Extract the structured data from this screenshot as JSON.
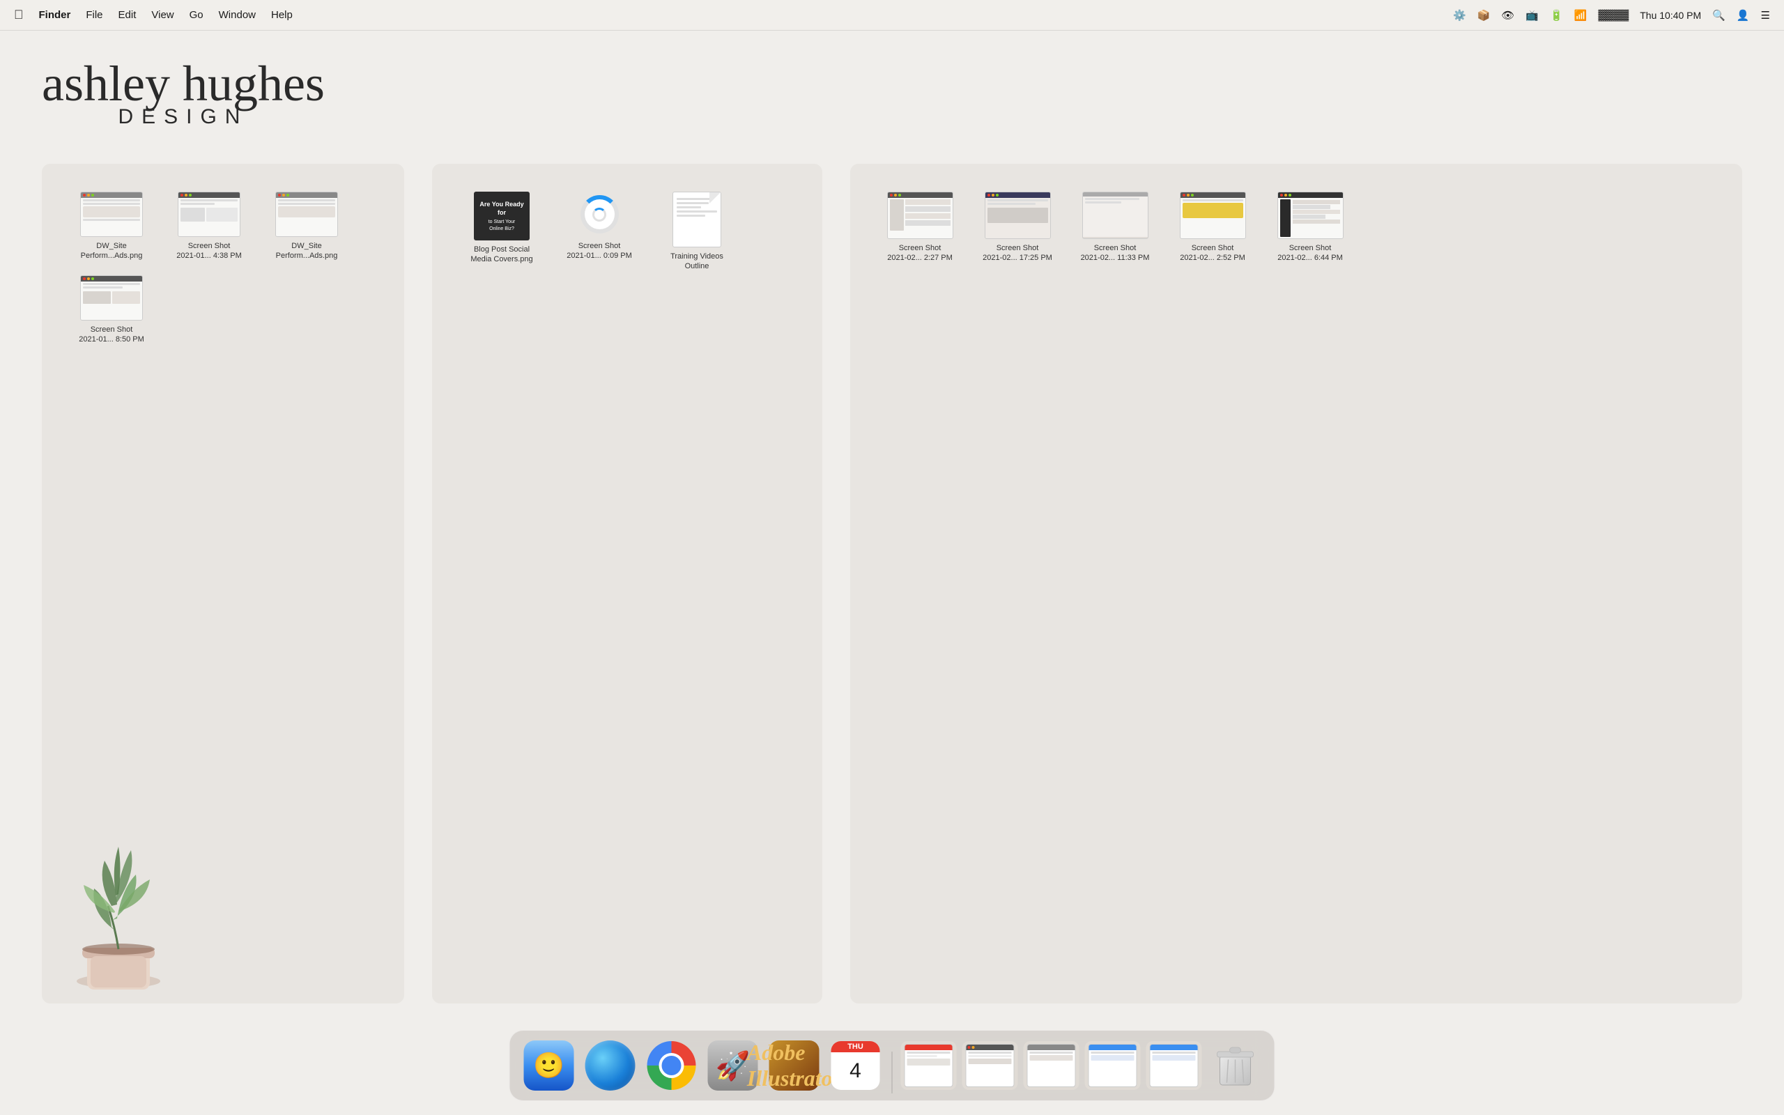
{
  "menubar": {
    "apple": "🍎",
    "app_name": "Finder",
    "menus": [
      "File",
      "Edit",
      "View",
      "Go",
      "Window",
      "Help"
    ],
    "time": "Thu 10:40 PM",
    "right_icons": [
      "gear",
      "dropbox",
      "screenium",
      "airplay",
      "battery-saver",
      "wifi",
      "battery",
      "search",
      "avatar",
      "controls"
    ]
  },
  "logo": {
    "cursive": "ashley hughes",
    "design": "DESIGN"
  },
  "panel1": {
    "files": [
      {
        "label": "DW_Site\nPerform...Ads.png",
        "type": "screenshot"
      },
      {
        "label": "Screen Shot\n2021-01... 4:38 PM",
        "type": "screenshot"
      },
      {
        "label": "DW_Site\nPerform...Ads.png",
        "type": "screenshot"
      },
      {
        "label": "Screen Shot\n2021-01... 8:50 PM",
        "type": "screenshot"
      }
    ]
  },
  "panel2": {
    "files": [
      {
        "label": "Blog Post Social\nMedia Covers.png",
        "type": "blog"
      },
      {
        "label": "Screen Shot\n2021-01... 0:09 PM",
        "type": "loading"
      },
      {
        "label": "Training Videos\nOutline",
        "type": "document"
      }
    ]
  },
  "panel3": {
    "files": [
      {
        "label": "Screen Shot\n2021-02... 2:27 PM",
        "type": "screenshot"
      },
      {
        "label": "Screen Shot\n2021-02... 17:25 PM",
        "type": "screenshot"
      },
      {
        "label": "Screen Shot\n2021-02... 11:33 PM",
        "type": "screenshot"
      },
      {
        "label": "Screen Shot\n2021-02... 2:52 PM",
        "type": "screenshot-yellow"
      },
      {
        "label": "Screen Shot\n2021-02... 6:44 PM",
        "type": "screenshot"
      }
    ]
  },
  "dock": {
    "items": [
      {
        "id": "finder",
        "label": "Finder"
      },
      {
        "id": "orbit",
        "label": "Orbit"
      },
      {
        "id": "chrome",
        "label": "Google Chrome"
      },
      {
        "id": "rocket",
        "label": "Rocket Typist"
      },
      {
        "id": "illustrator",
        "label": "Adobe Illustrator"
      },
      {
        "id": "calendar",
        "label": "Calendar",
        "cal_month": "THU",
        "cal_day": "4"
      },
      {
        "id": "divider"
      },
      {
        "id": "preview1",
        "label": "Preview Window 1"
      },
      {
        "id": "preview2",
        "label": "Preview Window 2"
      },
      {
        "id": "preview3",
        "label": "Preview Window 3"
      },
      {
        "id": "preview4",
        "label": "Preview Window 4"
      },
      {
        "id": "preview5",
        "label": "Preview Window 5"
      },
      {
        "id": "trash",
        "label": "Trash"
      }
    ],
    "calendar_month": "THU",
    "calendar_day": "4"
  }
}
